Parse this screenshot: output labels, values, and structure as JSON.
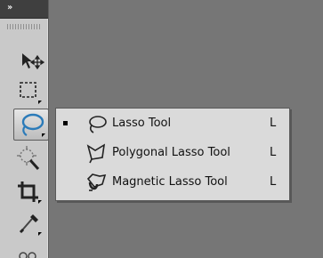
{
  "toolbar": {
    "collapse_glyph": "››",
    "tools": [
      {
        "name": "Move Tool",
        "icon": "move-icon"
      },
      {
        "name": "Rectangular Marquee Tool",
        "icon": "marquee-icon"
      },
      {
        "name": "Lasso Tool",
        "icon": "lasso-icon",
        "active": true
      },
      {
        "name": "Quick Selection Tool",
        "icon": "quick-selection-icon"
      },
      {
        "name": "Crop Tool",
        "icon": "crop-icon"
      },
      {
        "name": "Eyedropper Tool",
        "icon": "eyedropper-icon"
      }
    ]
  },
  "flyout_menu": {
    "items": [
      {
        "label": "Lasso Tool",
        "shortcut": "L",
        "icon": "lasso-icon",
        "selected": true
      },
      {
        "label": "Polygonal Lasso Tool",
        "shortcut": "L",
        "icon": "polygonal-lasso-icon",
        "selected": false
      },
      {
        "label": "Magnetic Lasso Tool",
        "shortcut": "L",
        "icon": "magnetic-lasso-icon",
        "selected": false
      }
    ]
  },
  "colors": {
    "canvas": "#767676",
    "panel": "#c9c9c9",
    "menu": "#dadada",
    "lasso_accent": "#2b7bb9"
  }
}
